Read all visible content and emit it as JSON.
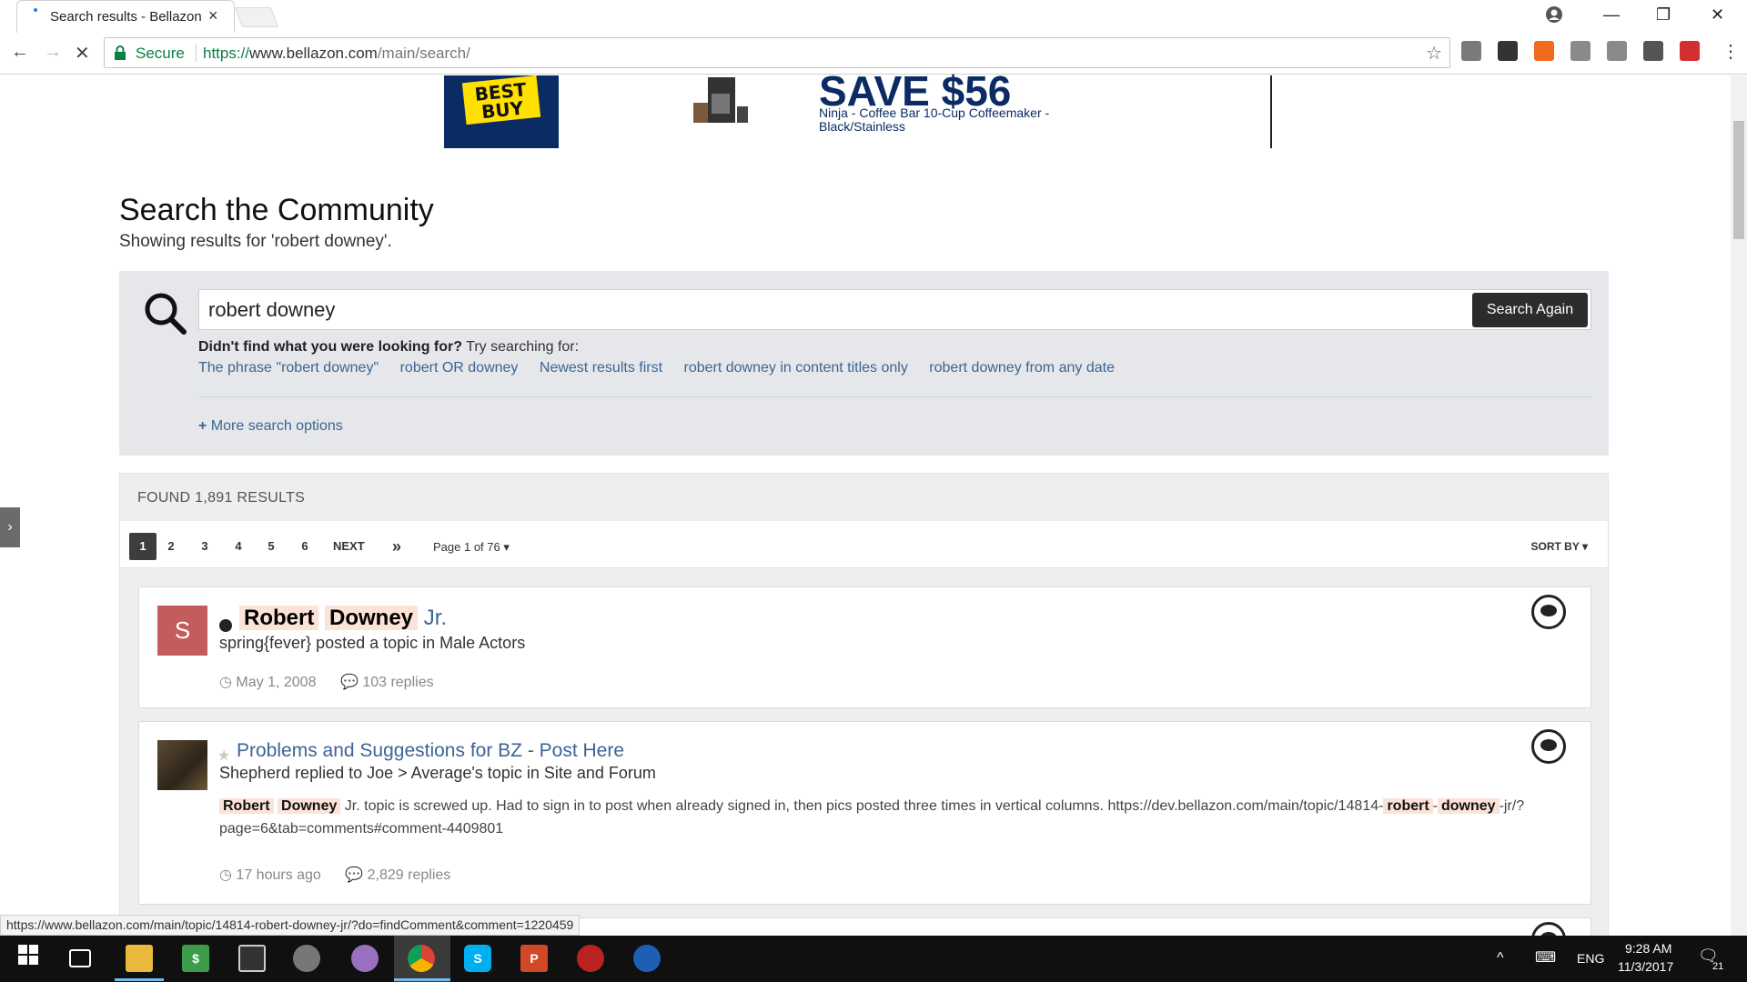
{
  "browser": {
    "tab_title": "Search results - Bellazon",
    "secure_label": "Secure",
    "url_scheme": "https://",
    "url_host": "www.bellazon.com",
    "url_path": "/main/search/",
    "status_url": "https://www.bellazon.com/main/topic/14814-robert-downey-jr/?do=findComment&comment=1220459"
  },
  "extensions": [
    {
      "name": "SA",
      "color": "#7a7a7a"
    },
    {
      "name": "M",
      "color": "#333333"
    },
    {
      "name": "chart",
      "color": "#f26b1d"
    },
    {
      "name": "gear",
      "color": "#8a8a8a"
    },
    {
      "name": "ABP",
      "color": "#8a8a8a"
    },
    {
      "name": "globe",
      "color": "#555555"
    },
    {
      "name": "badge",
      "color": "#d32f2f"
    }
  ],
  "ad": {
    "brand": "BEST BUY",
    "headline": "SAVE $56",
    "description": "Ninja - Coffee Bar 10-Cup Coffeemaker - Black/Stainless"
  },
  "page": {
    "title": "Search the Community",
    "subtitle": "Showing results for 'robert downey'."
  },
  "search": {
    "query": "robert downey",
    "button_label": "Search Again",
    "hint_bold": "Didn't find what you were looking for?",
    "hint_rest": " Try searching for:",
    "alternatives": [
      "The phrase \"robert downey\"",
      "robert OR downey",
      "Newest results first",
      "robert downey in content titles only",
      "robert downey from any date"
    ],
    "more_options": "More search options"
  },
  "results": {
    "found_label": "FOUND 1,891 RESULTS",
    "pages": [
      "1",
      "2",
      "3",
      "4",
      "5",
      "6"
    ],
    "next_label": "NEXT",
    "last_label": "»",
    "page_of": "Page 1 of 76",
    "sort_label": "SORT BY",
    "items": [
      {
        "title_hl_1": "Robert",
        "title_hl_2": "Downey",
        "title_rest": "Jr.",
        "avatar_letter": "S",
        "byline": "spring{fever} posted a topic in Male Actors",
        "date": "May 1, 2008",
        "replies": "103 replies"
      },
      {
        "title": "Problems and Suggestions for BZ - Post Here",
        "byline": "Shepherd replied to Joe > Average's topic in Site and Forum",
        "snippet_hl_1": "Robert",
        "snippet_hl_2": "Downey",
        "snippet_mid": " Jr. topic is screwed up. Had to sign in to post when already signed in, then pics posted three times in vertical columns. https://dev.bellazon.com/main/topic/14814-",
        "snippet_hl_3": "robert",
        "snippet_dash": "-",
        "snippet_hl_4": "downey",
        "snippet_end": "-jr/?page=6&tab=comments#comment-4409801",
        "date": "17 hours ago",
        "replies": "2,829 replies"
      }
    ]
  },
  "taskbar": {
    "language": "ENG",
    "time": "9:28 AM",
    "date": "11/3/2017",
    "notification_count": "21"
  }
}
